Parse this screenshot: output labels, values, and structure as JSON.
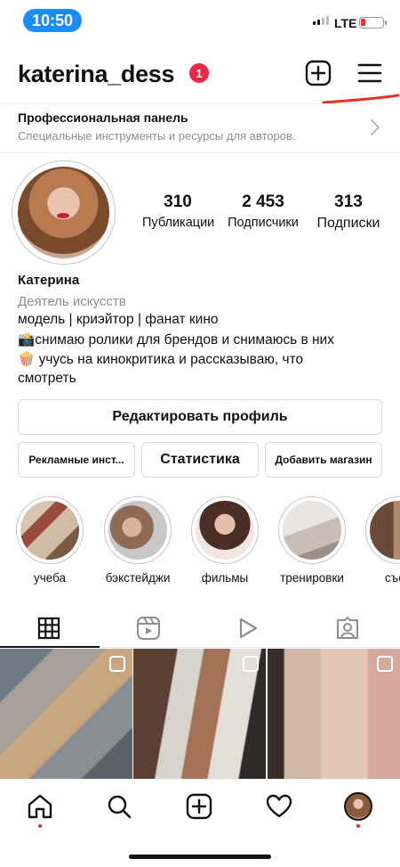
{
  "status_bar": {
    "time": "10:50",
    "network": "LTE",
    "battery_level": "low"
  },
  "header": {
    "username": "katerina_dess",
    "notification_count": "1",
    "icons": [
      "plus-square-icon",
      "menu-icon"
    ]
  },
  "pro_panel": {
    "title": "Профессиональная панель",
    "subtitle": "Специальные инструменты и ресурсы для авторов."
  },
  "profile": {
    "stats": [
      {
        "value": "310",
        "label": "Публикации"
      },
      {
        "value": "2 453",
        "label": "Подписчики"
      },
      {
        "value": "313",
        "label": "Подписки"
      }
    ],
    "name": "Катерина",
    "category": "Деятель искусств",
    "bio": [
      "модель | криэйтор | фанат кино",
      "📸снимаю ролики для брендов и снимаюсь в них",
      "🍿 учусь на кинокритика и рассказываю, что",
      "смотреть"
    ]
  },
  "buttons": {
    "edit_profile": "Редактировать профиль",
    "ads": "Рекламные инст...",
    "stats": "Статистика",
    "add_shop": "Добавить магазин"
  },
  "highlights": [
    {
      "label": "учеба"
    },
    {
      "label": "бэкстейджи"
    },
    {
      "label": "фильмы"
    },
    {
      "label": "тренировки"
    },
    {
      "label": "съем"
    }
  ],
  "tabs": [
    "grid-icon",
    "reels-icon",
    "video-icon",
    "tagged-icon"
  ],
  "bottom_nav": [
    "home-icon",
    "search-icon",
    "create-icon",
    "heart-icon",
    "profile-avatar"
  ],
  "colors": {
    "accent": "#1a8cff",
    "badge": "#ed2847",
    "annotation": "#e5322d"
  }
}
